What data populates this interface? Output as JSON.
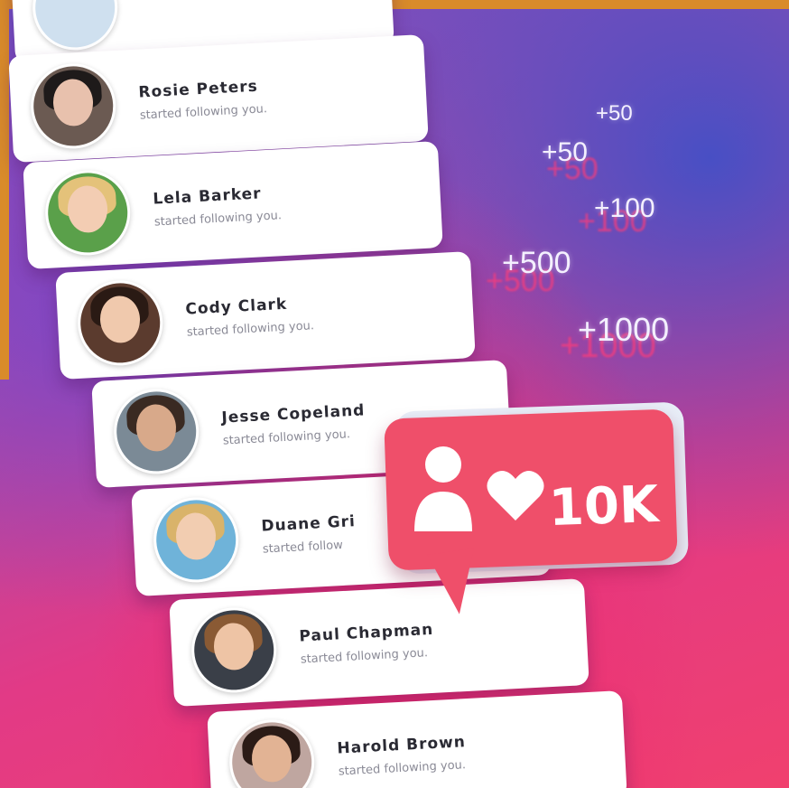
{
  "notifications": [
    {
      "name": "",
      "action": ""
    },
    {
      "name": "Rosie Peters",
      "action": "started following you."
    },
    {
      "name": "Lela Barker",
      "action": "started following you."
    },
    {
      "name": "Cody Clark",
      "action": "started following you."
    },
    {
      "name": "Jesse Copeland",
      "action": "started following you."
    },
    {
      "name": "Duane Gri",
      "action": "started follow"
    },
    {
      "name": "Paul Chapman",
      "action": "started following you."
    },
    {
      "name": "Harold Brown",
      "action": "started following you."
    }
  ],
  "floating_counts": [
    "+50",
    "+50",
    "+100",
    "+500",
    "+1000"
  ],
  "badge": {
    "count": "10K",
    "icons": [
      "person-icon",
      "heart-icon"
    ],
    "color": "#ef4f6a"
  },
  "colors": {
    "background_top": "#6d4fc7",
    "background_bottom": "#f0406e",
    "frame": "#d98b2a"
  }
}
